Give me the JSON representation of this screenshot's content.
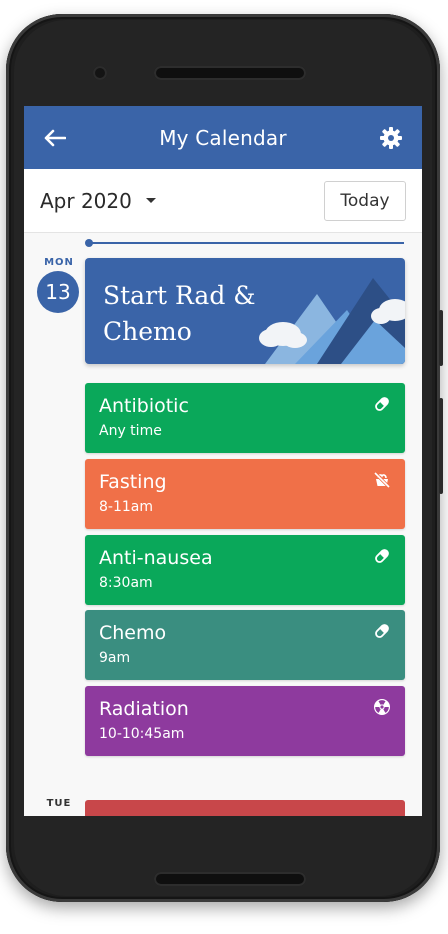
{
  "app": {
    "title": "My Calendar",
    "accent": "#3a64a8"
  },
  "header": {
    "back_icon": "arrow-left-icon",
    "settings_icon": "gear-icon"
  },
  "month_bar": {
    "month": "Apr 2020",
    "today_label": "Today"
  },
  "days": [
    {
      "weekday": "MON",
      "date": "13",
      "highlight": {
        "title": "Start Rad & Chemo",
        "art": "mountains-clouds-illustration"
      },
      "events": [
        {
          "name": "Antibiotic",
          "time": "Any time",
          "color": "#0aa85a",
          "icon": "pill-icon"
        },
        {
          "name": "Fasting",
          "time": "8-11am",
          "color": "#f07048",
          "icon": "no-food-icon"
        },
        {
          "name": "Anti-nausea",
          "time": "8:30am",
          "color": "#0aa85a",
          "icon": "pill-icon"
        },
        {
          "name": "Chemo",
          "time": "9am",
          "color": "#3a8e80",
          "icon": "pill-icon"
        },
        {
          "name": "Radiation",
          "time": "10-10:45am",
          "color": "#8e3a9e",
          "icon": "radiation-icon"
        }
      ]
    },
    {
      "weekday": "TUE",
      "next_event_color": "#c8474a"
    }
  ]
}
